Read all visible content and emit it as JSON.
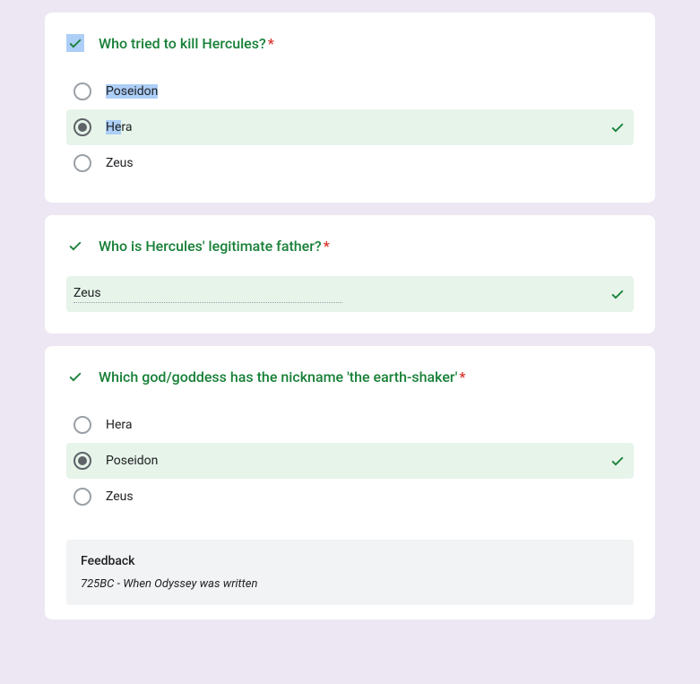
{
  "colors": {
    "correct": "#188038",
    "error": "#d93025",
    "highlight": "#accef7"
  },
  "questions": [
    {
      "icon_style": "highlighted",
      "text": "Who tried to kill Hercules?",
      "required": "*",
      "options": [
        {
          "label": "Poseidon",
          "selected": false,
          "correct": false,
          "highlighted": true
        },
        {
          "label": "Hera",
          "selected": true,
          "correct": true,
          "highlighted_prefix": "He",
          "highlighted_suffix": "ra"
        },
        {
          "label": "Zeus",
          "selected": false,
          "correct": false
        }
      ]
    },
    {
      "icon_style": "plain",
      "text": "Who is Hercules' legitimate father?",
      "required": "*",
      "text_answer": "Zeus",
      "correct": true
    },
    {
      "icon_style": "plain",
      "text": "Which god/goddess has the nickname 'the earth-shaker'",
      "required": "*",
      "options": [
        {
          "label": "Hera",
          "selected": false,
          "correct": false
        },
        {
          "label": "Poseidon",
          "selected": true,
          "correct": true
        },
        {
          "label": "Zeus",
          "selected": false,
          "correct": false
        }
      ],
      "feedback": {
        "title": "Feedback",
        "text": "725BC - When Odyssey was written"
      }
    }
  ]
}
